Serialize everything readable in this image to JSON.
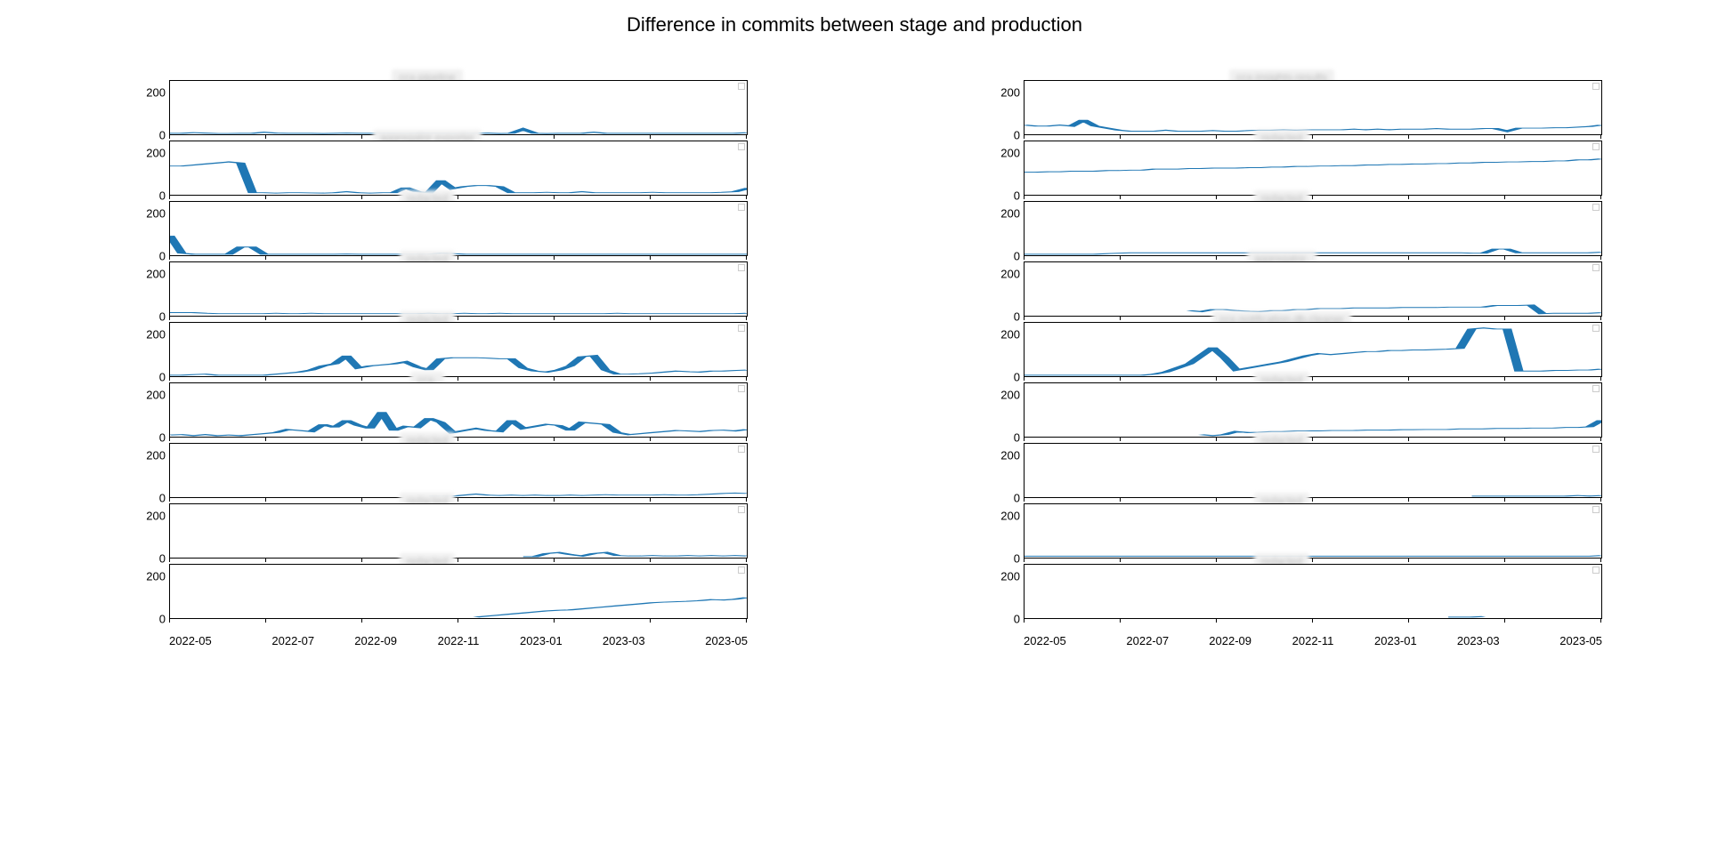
{
  "title": "Difference in commits between stage and production",
  "xlabels": [
    "2022-05",
    "2022-07",
    "2022-09",
    "2022-11",
    "2023-01",
    "2023-03",
    "2023-05"
  ],
  "yticks": [
    0,
    200
  ],
  "ymax": 260,
  "chart_data": [
    {
      "column": 0,
      "index": 0,
      "type": "line",
      "title": "ccx-pipeline",
      "title_redacted": true,
      "x_start": 0,
      "values": [
        5,
        5,
        8,
        6,
        4,
        4,
        5,
        5,
        10,
        6,
        5,
        5,
        5,
        4,
        5,
        6,
        5,
        5,
        5,
        5,
        4,
        5,
        5,
        5,
        4,
        4,
        5,
        6,
        4,
        5,
        25,
        5,
        4,
        5,
        5,
        5,
        10,
        5,
        5,
        5,
        5,
        5,
        5,
        5,
        5,
        5,
        5,
        5,
        5,
        8
      ]
    },
    {
      "column": 0,
      "index": 1,
      "type": "line",
      "title": "aggregator-exporter",
      "title_redacted": true,
      "x_start": 0,
      "values": [
        140,
        140,
        145,
        150,
        155,
        160,
        155,
        10,
        10,
        8,
        10,
        10,
        9,
        8,
        10,
        15,
        10,
        8,
        10,
        10,
        35,
        15,
        10,
        70,
        30,
        40,
        45,
        45,
        40,
        10,
        10,
        10,
        12,
        10,
        10,
        15,
        10,
        10,
        10,
        10,
        10,
        12,
        10,
        10,
        10,
        10,
        10,
        12,
        15,
        30,
        25
      ]
    },
    {
      "column": 0,
      "index": 2,
      "type": "line",
      "title": "redacted",
      "title_redacted": true,
      "x_start": 0,
      "values": [
        95,
        10,
        5,
        5,
        5,
        5,
        40,
        40,
        5,
        5,
        5,
        5,
        5,
        5,
        5,
        6,
        5,
        5,
        5,
        5,
        5,
        5,
        5,
        10,
        8,
        5,
        5,
        5,
        5,
        5,
        5,
        5,
        5,
        5,
        5,
        5,
        5,
        5,
        5,
        5,
        5,
        5,
        5,
        5,
        5,
        5,
        5,
        5,
        5,
        5
      ]
    },
    {
      "column": 0,
      "index": 3,
      "type": "line",
      "title": "redacted",
      "title_redacted": true,
      "x_start": 0,
      "values": [
        15,
        15,
        15,
        12,
        10,
        10,
        10,
        10,
        10,
        12,
        10,
        10,
        12,
        10,
        10,
        10,
        10,
        10,
        10,
        10,
        10,
        10,
        12,
        10,
        10,
        12,
        10,
        10,
        12,
        10,
        10,
        10,
        10,
        10,
        10,
        10,
        10,
        10,
        12,
        10,
        10,
        10,
        10,
        10,
        10,
        10,
        10,
        10,
        10,
        12
      ]
    },
    {
      "column": 0,
      "index": 4,
      "type": "line",
      "title": "redacted",
      "title_redacted": true,
      "x_start": 0,
      "values": [
        5,
        5,
        8,
        10,
        5,
        5,
        5,
        5,
        5,
        10,
        15,
        20,
        30,
        50,
        60,
        100,
        40,
        50,
        55,
        60,
        70,
        45,
        30,
        85,
        90,
        90,
        90,
        88,
        85,
        85,
        40,
        25,
        20,
        30,
        50,
        95,
        100,
        30,
        10,
        10,
        12,
        15,
        20,
        25,
        22,
        20,
        25,
        25,
        28,
        30
      ]
    },
    {
      "column": 0,
      "index": 5,
      "type": "line",
      "title": "ccx-",
      "title_redacted": true,
      "x_start": 0,
      "values": [
        8,
        10,
        5,
        10,
        5,
        8,
        5,
        10,
        15,
        20,
        35,
        30,
        25,
        60,
        45,
        80,
        55,
        40,
        120,
        30,
        50,
        45,
        90,
        70,
        20,
        30,
        40,
        30,
        25,
        80,
        40,
        50,
        60,
        55,
        30,
        70,
        65,
        60,
        20,
        10,
        15,
        20,
        25,
        30,
        28,
        25,
        30,
        32,
        28,
        35
      ]
    },
    {
      "column": 0,
      "index": 6,
      "type": "line",
      "title": "redacted",
      "title_redacted": true,
      "x_start": 22,
      "values": [
        5,
        5,
        5,
        10,
        15,
        10,
        8,
        10,
        8,
        10,
        8,
        8,
        10,
        8,
        10,
        12,
        10,
        10,
        10,
        10,
        12,
        10,
        10,
        12,
        15,
        18,
        20,
        18
      ]
    },
    {
      "column": 0,
      "index": 7,
      "type": "line",
      "title": "redacted",
      "title_redacted": true,
      "x_start": 30,
      "values": [
        5,
        5,
        20,
        25,
        15,
        8,
        20,
        25,
        10,
        8,
        8,
        10,
        8,
        8,
        10,
        8,
        10,
        8,
        10,
        8
      ]
    },
    {
      "column": 0,
      "index": 8,
      "type": "line",
      "title": "redacted",
      "title_redacted": true,
      "x_start": 26,
      "values": [
        5,
        10,
        15,
        20,
        25,
        30,
        35,
        38,
        40,
        45,
        50,
        55,
        60,
        65,
        70,
        75,
        78,
        80,
        82,
        85,
        90,
        88,
        92,
        100
      ]
    },
    {
      "column": 1,
      "index": 0,
      "type": "line",
      "title": "ccx-insights-results",
      "title_redacted": true,
      "x_start": 0,
      "values": [
        45,
        40,
        40,
        45,
        40,
        70,
        40,
        30,
        20,
        15,
        15,
        15,
        20,
        15,
        15,
        15,
        18,
        15,
        15,
        18,
        20,
        20,
        22,
        20,
        22,
        22,
        22,
        22,
        25,
        22,
        25,
        22,
        25,
        25,
        25,
        28,
        25,
        25,
        25,
        28,
        28,
        15,
        30,
        30,
        30,
        32,
        32,
        35,
        38,
        45
      ]
    },
    {
      "column": 1,
      "index": 1,
      "type": "line",
      "title": "redacted",
      "title_redacted": true,
      "x_start": 0,
      "values": [
        110,
        110,
        112,
        112,
        115,
        115,
        115,
        118,
        118,
        120,
        120,
        125,
        125,
        125,
        128,
        128,
        130,
        130,
        130,
        132,
        132,
        135,
        135,
        138,
        138,
        140,
        140,
        142,
        142,
        145,
        145,
        148,
        148,
        150,
        150,
        152,
        152,
        155,
        155,
        158,
        158,
        160,
        160,
        162,
        162,
        165,
        165,
        170,
        170,
        175
      ]
    },
    {
      "column": 1,
      "index": 2,
      "type": "line",
      "title": "redacted",
      "title_redacted": true,
      "x_start": 0,
      "values": [
        5,
        5,
        5,
        5,
        5,
        5,
        5,
        8,
        10,
        12,
        12,
        12,
        12,
        12,
        12,
        12,
        12,
        12,
        12,
        12,
        12,
        12,
        12,
        12,
        12,
        12,
        12,
        12,
        12,
        12,
        12,
        12,
        12,
        12,
        12,
        12,
        12,
        12,
        10,
        10,
        30,
        30,
        12,
        12,
        12,
        12,
        12,
        12,
        12,
        15
      ]
    },
    {
      "column": 1,
      "index": 3,
      "type": "line",
      "title": "aggregator-",
      "title_redacted": true,
      "x_start": 14,
      "values": [
        25,
        20,
        30,
        30,
        25,
        22,
        20,
        25,
        25,
        30,
        30,
        35,
        35,
        35,
        38,
        38,
        38,
        38,
        40,
        40,
        40,
        40,
        42,
        42,
        42,
        42,
        50,
        50,
        50,
        52,
        10,
        12,
        12,
        12,
        12,
        15
      ]
    },
    {
      "column": 1,
      "index": 4,
      "type": "line",
      "title": "ccx-notification-db-cleaner",
      "title_redacted": true,
      "x_start": 0,
      "values": [
        5,
        5,
        5,
        5,
        5,
        5,
        5,
        5,
        5,
        5,
        5,
        10,
        20,
        40,
        60,
        100,
        140,
        90,
        30,
        40,
        50,
        60,
        70,
        85,
        100,
        110,
        105,
        110,
        115,
        120,
        120,
        125,
        125,
        128,
        128,
        130,
        132,
        135,
        230,
        235,
        230,
        230,
        25,
        25,
        25,
        28,
        28,
        30,
        30,
        35
      ]
    },
    {
      "column": 1,
      "index": 5,
      "type": "line",
      "title": "redacted",
      "title_redacted": true,
      "x_start": 15,
      "values": [
        10,
        5,
        10,
        25,
        20,
        22,
        25,
        25,
        28,
        28,
        28,
        30,
        30,
        30,
        32,
        32,
        32,
        34,
        34,
        35,
        35,
        35,
        38,
        38,
        38,
        40,
        40,
        40,
        42,
        42,
        42,
        45,
        45,
        48,
        80
      ]
    },
    {
      "column": 1,
      "index": 6,
      "type": "line",
      "title": "redacted",
      "title_redacted": true,
      "x_start": 38,
      "values": [
        5,
        5,
        5,
        5,
        5,
        5,
        5,
        5,
        5,
        8,
        5,
        8
      ]
    },
    {
      "column": 1,
      "index": 7,
      "type": "line",
      "title": "redacted",
      "title_redacted": true,
      "x_start": 0,
      "values": [
        7,
        7,
        7,
        7,
        7,
        7,
        7,
        7,
        7,
        7,
        7,
        7,
        7,
        7,
        7,
        7,
        7,
        7,
        7,
        7,
        7,
        7,
        7,
        7,
        7,
        7,
        7,
        7,
        7,
        7,
        7,
        7,
        7,
        7,
        7,
        7,
        7,
        7,
        7,
        7,
        7,
        7,
        7,
        7,
        7,
        7,
        7,
        7,
        7,
        10
      ]
    },
    {
      "column": 1,
      "index": 8,
      "type": "line",
      "title": "redacted",
      "title_redacted": true,
      "x_start": 36,
      "values": [
        5,
        5,
        5,
        8
      ]
    }
  ]
}
